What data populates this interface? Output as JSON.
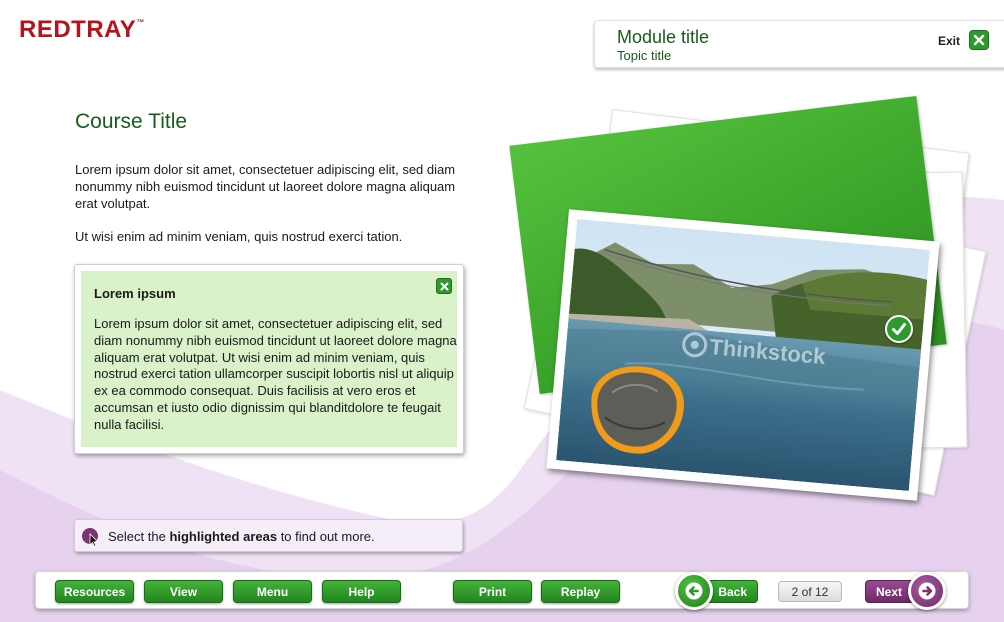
{
  "brand": {
    "logo_text": "REDTRAY",
    "logo_mark": "™"
  },
  "header": {
    "module_title": "Module title",
    "topic_title": "Topic title",
    "exit_label": "Exit"
  },
  "content": {
    "course_title": "Course Title",
    "paragraph_1": "Lorem ipsum dolor sit amet, consectetuer adipiscing elit, sed diam nonummy nibh euismod tincidunt ut laoreet dolore magna aliquam erat volutpat.",
    "paragraph_2": "Ut wisi enim ad minim veniam, quis nostrud exerci tation."
  },
  "popup": {
    "heading": "Lorem ipsum",
    "body": "Lorem ipsum dolor sit amet, consectetuer adipiscing elit, sed diam nonummy nibh euismod tincidunt ut laoreet dolore magna aliquam erat volutpat. Ut wisi enim ad minim veniam, quis nostrud exerci tation ullamcorper suscipit lobortis nisl ut aliquip ex ea commodo consequat. Duis facilisis at vero eros et accumsan et iusto odio dignissim qui blanditdolore te feugait nulla facilisi."
  },
  "instruction": {
    "prefix": "Select the ",
    "highlight": "highlighted areas",
    "suffix": " to find out more."
  },
  "image": {
    "watermark": "Thinkstock"
  },
  "nav": {
    "resources": "Resources",
    "view": "View",
    "menu": "Menu",
    "help": "Help",
    "print": "Print",
    "replay": "Replay",
    "back": "Back",
    "next": "Next",
    "page_counter": "2 of 12"
  },
  "colors": {
    "brand_red": "#b5141c",
    "primary_green": "#2e9a2e",
    "title_green": "#155d1a",
    "popup_bg": "#d9f2c9",
    "accent_purple": "#7a3373",
    "wave_purple": "#ecdcf2"
  },
  "icons": {
    "exit": "close-icon",
    "popup_close": "close-icon",
    "instruction": "pointer-cursor-icon",
    "hotspot_done": "checkmark-icon",
    "back": "arrow-left-icon",
    "next": "arrow-right-icon"
  }
}
